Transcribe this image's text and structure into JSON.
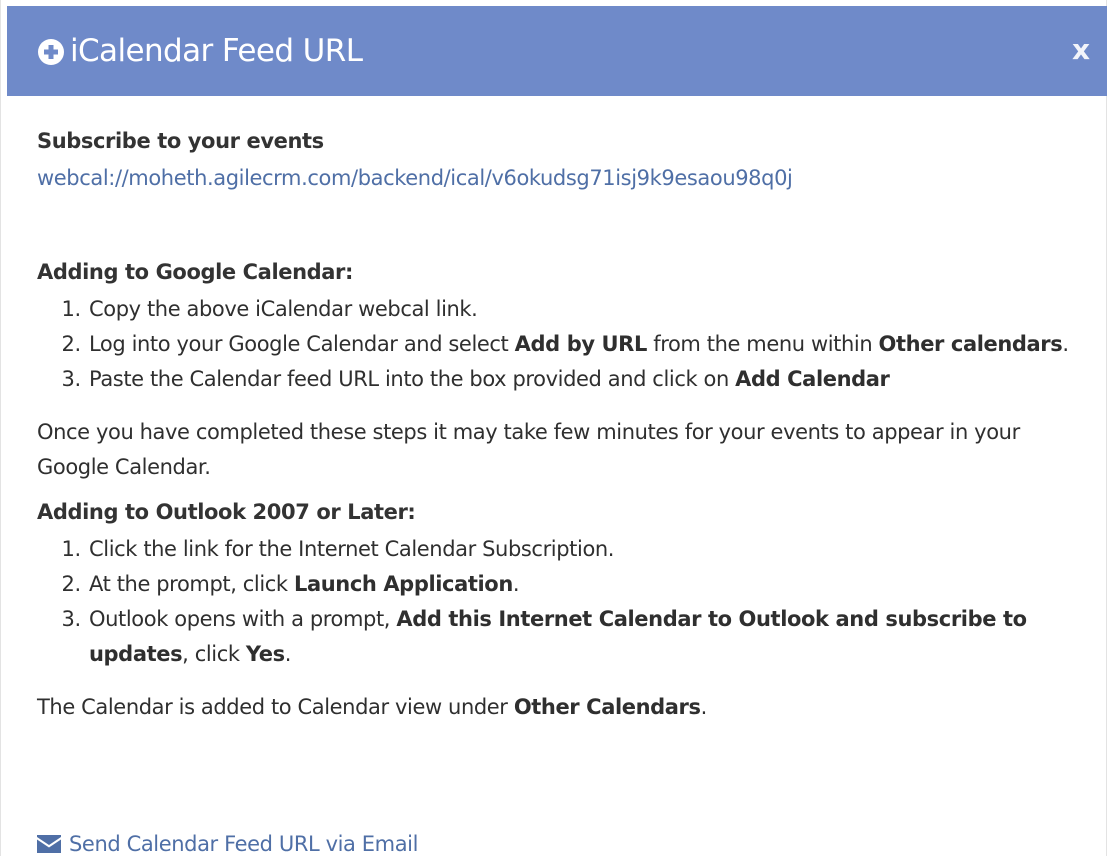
{
  "modal": {
    "title": "iCalendar Feed URL",
    "close_label": "x"
  },
  "subscribe": {
    "heading": "Subscribe to your events",
    "url": "webcal://moheth.agilecrm.com/backend/ical/v6okudsg71isj9k9esaou98q0j"
  },
  "google": {
    "title": "Adding to Google Calendar:",
    "step1": "Copy the above iCalendar webcal link.",
    "step2_pre": "Log into your Google Calendar and select ",
    "step2_bold1": "Add by URL",
    "step2_mid": " from the menu within ",
    "step2_bold2": "Other calendars",
    "step2_post": ".",
    "step3_pre": "Paste the Calendar feed URL into the box provided and click on ",
    "step3_bold": "Add Calendar",
    "note": "Once you have completed these steps it may take few minutes for your events to appear in your Google Calendar."
  },
  "outlook": {
    "title": "Adding to Outlook 2007 or Later:",
    "step1": "Click the link for the Internet Calendar Subscription.",
    "step2_pre": "At the prompt, click ",
    "step2_bold": "Launch Application",
    "step2_post": ".",
    "step3_pre": "Outlook opens with a prompt, ",
    "step3_bold1": "Add this Internet Calendar to Outlook and subscribe to updates",
    "step3_mid": ", click ",
    "step3_bold2": "Yes",
    "step3_post": ".",
    "note_pre": "The Calendar is added to Calendar view under ",
    "note_bold": "Other Calendars",
    "note_post": "."
  },
  "email": {
    "label": "Send Calendar Feed URL via Email"
  },
  "colors": {
    "header_bg": "#6f8ac9",
    "link": "#4f6fa6"
  },
  "icons": {
    "header": "plus-circle-icon",
    "close": "close-icon",
    "email": "envelope-icon"
  }
}
